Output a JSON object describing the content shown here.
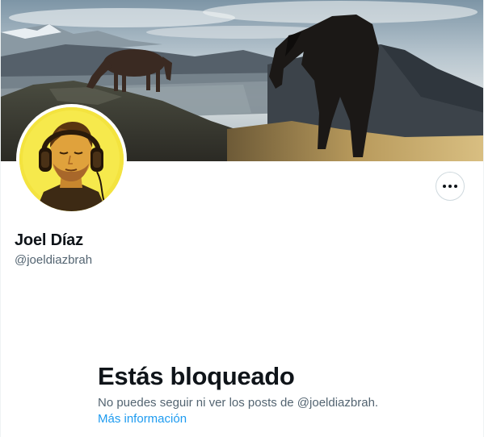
{
  "profile": {
    "display_name": "Joel Díaz",
    "handle": "@joeldiazbrah"
  },
  "header_image": {
    "subject": "two horses on a mountain ridge at sunset"
  },
  "avatar": {
    "subject": "man wearing headphones, yellow toned portrait"
  },
  "actions": {
    "more_icon": "more-horizontal-icon"
  },
  "blocked": {
    "title": "Estás bloqueado",
    "description": "No puedes seguir ni ver los posts de @joeldiazbrah.",
    "learn_more": "Más información"
  },
  "colors": {
    "text_primary": "#0f1419",
    "text_secondary": "#536471",
    "link": "#1d9bf0",
    "border": "#cfd9de"
  }
}
